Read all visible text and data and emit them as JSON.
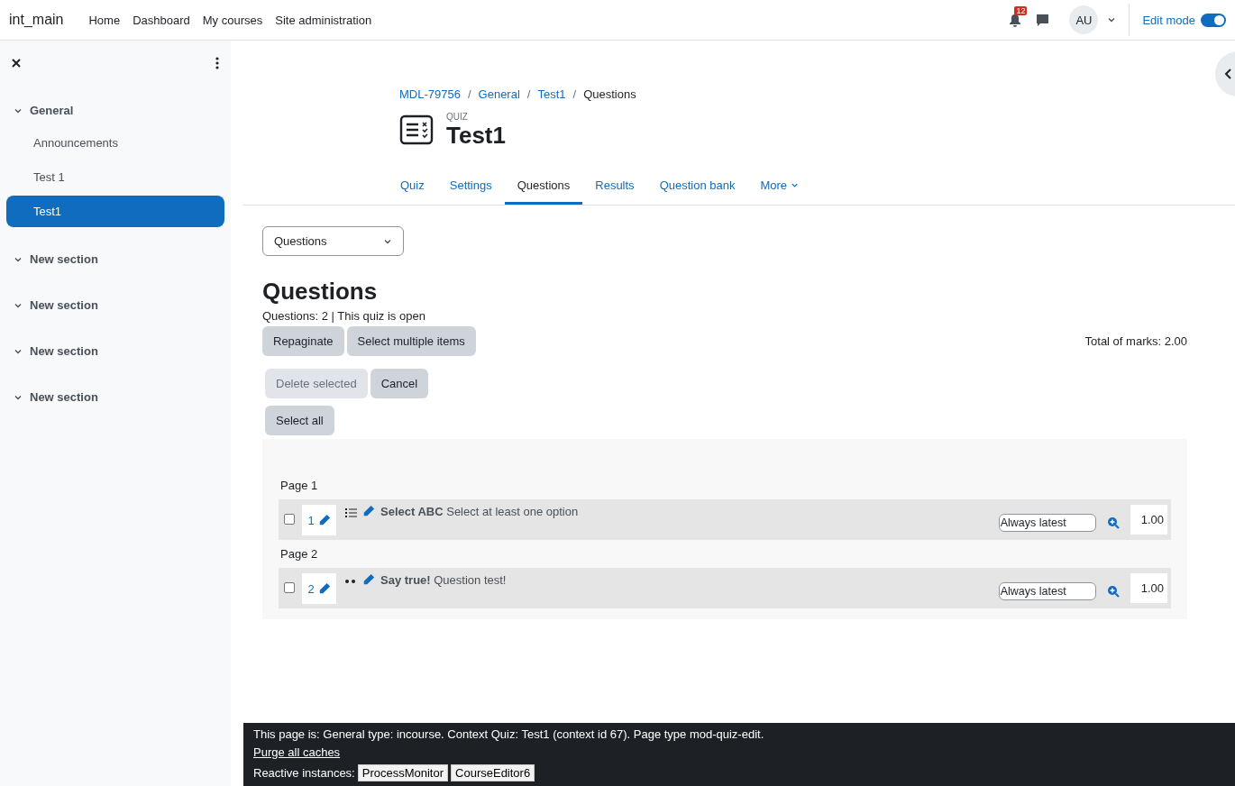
{
  "navbar": {
    "brand": "int_main",
    "links": [
      "Home",
      "Dashboard",
      "My courses",
      "Site administration"
    ],
    "notification_count": "12",
    "avatar": "AU",
    "edit_mode": {
      "label": "Edit mode",
      "on": true
    }
  },
  "sidebar": {
    "sections": [
      {
        "title": "General",
        "expanded": true,
        "children": [
          {
            "label": "Announcements",
            "selected": false
          },
          {
            "label": "Test 1",
            "selected": false
          },
          {
            "label": "Test1",
            "selected": true
          }
        ]
      },
      {
        "title": "New section",
        "expanded": true
      },
      {
        "title": "New section",
        "expanded": true
      },
      {
        "title": "New section",
        "expanded": true
      },
      {
        "title": "New section",
        "expanded": true
      }
    ]
  },
  "breadcrumb": {
    "separator": "/",
    "items": [
      {
        "label": "MDL-79756",
        "link": true
      },
      {
        "label": "General",
        "link": true
      },
      {
        "label": "Test1",
        "link": true
      },
      {
        "label": "Questions",
        "link": false
      }
    ]
  },
  "activity": {
    "type": "QUIZ",
    "title": "Test1"
  },
  "tabs": [
    {
      "label": "Quiz",
      "selected": false
    },
    {
      "label": "Settings",
      "selected": false
    },
    {
      "label": "Questions",
      "selected": true
    },
    {
      "label": "Results",
      "selected": false
    },
    {
      "label": "Question bank",
      "selected": false
    },
    {
      "label": "More",
      "selected": false,
      "menu": true
    }
  ],
  "view_select": "Questions",
  "heading": "Questions",
  "status": "Questions: 2 | This quiz is open",
  "buttons_row1": [
    "Repaginate",
    "Select multiple items"
  ],
  "total_marks": "Total of marks: 2.00",
  "buttons_row2": [
    {
      "label": "Delete selected",
      "disabled": true
    },
    {
      "label": "Cancel",
      "disabled": false
    }
  ],
  "select_all": "Select all",
  "pages": [
    {
      "label": "Page 1",
      "questions": [
        {
          "number": "1",
          "kind": "multichoice",
          "name": "Select ABC",
          "text": "Select at least one option",
          "checked": false,
          "version": "Always latest",
          "mark": "1.00"
        }
      ]
    },
    {
      "label": "Page 2",
      "questions": [
        {
          "number": "2",
          "kind": "truefalse",
          "name": "Say true!",
          "text": "Question test!",
          "checked": false,
          "version": "Always latest",
          "mark": "1.00"
        }
      ]
    }
  ],
  "footer": {
    "info": "This page is: General type: incourse. Context Quiz: Test1 (context id 67). Page type mod-quiz-edit.",
    "purge_link": "Purge all caches",
    "reactive_label": "Reactive instances:",
    "reactive_buttons": [
      "ProcessMonitor",
      "CourseEditor6"
    ]
  }
}
